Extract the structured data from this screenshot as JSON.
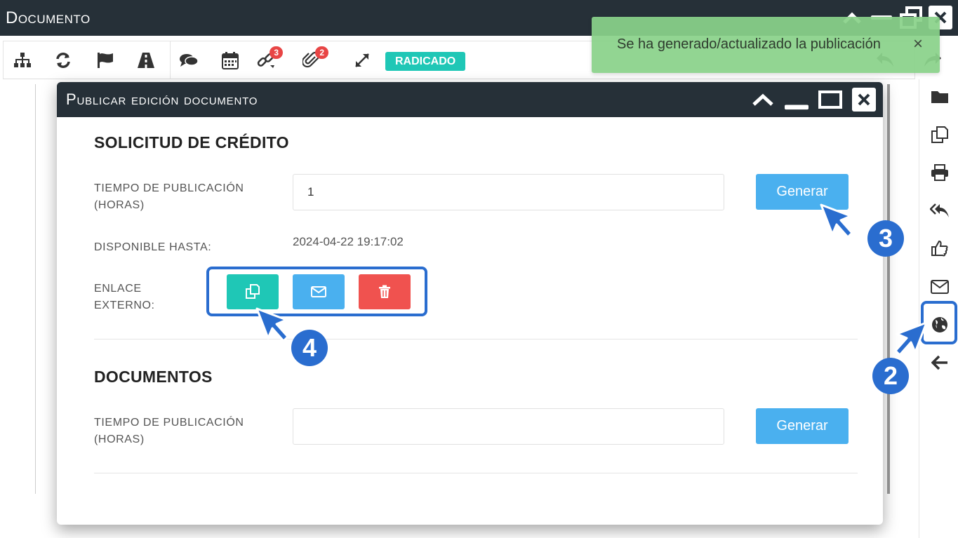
{
  "window": {
    "title": "Documento"
  },
  "toolbar": {
    "links_badge": "3",
    "attachments_badge": "2",
    "status_tag": "RADICADO"
  },
  "toast": {
    "message": "Se ha generado/actualizado la publicación",
    "close": "×"
  },
  "modal": {
    "title": "Publicar edición documento",
    "sections": [
      {
        "title": "SOLICITUD DE CRÉDITO",
        "time_label": "TIEMPO DE PUBLICACIÓN (HORAS)",
        "time_value": "1",
        "generate_label": "Generar",
        "available_label": "DISPONIBLE HASTA:",
        "available_value": "2024-04-22 19:17:02",
        "external_link_label": "ENLACE EXTERNO:"
      },
      {
        "title": "DOCUMENTOS",
        "time_label": "TIEMPO DE PUBLICACIÓN (HORAS)",
        "time_value": "",
        "generate_label": "Generar"
      }
    ]
  },
  "annotations": {
    "step2": "2",
    "step3": "3",
    "step4": "4"
  },
  "colors": {
    "titlebar": "#263038",
    "accent_teal": "#1fc7b6",
    "accent_blue": "#4ab0ef",
    "danger": "#f0524f",
    "badge": "#e84545",
    "annotation": "#2a6dcf",
    "toast": "#8ad28a"
  },
  "icons": {
    "toolbar": [
      "sitemap-icon",
      "refresh-icon",
      "flag-icon",
      "road-icon",
      "comments-icon",
      "calendar-icon",
      "link-icon",
      "paperclip-icon",
      "expand-icon"
    ],
    "sidebar": [
      "folder-icon",
      "copy-icon",
      "print-icon",
      "reply-all-icon",
      "thumbs-up-icon",
      "envelope-icon",
      "globe-icon",
      "arrow-left-icon"
    ]
  }
}
